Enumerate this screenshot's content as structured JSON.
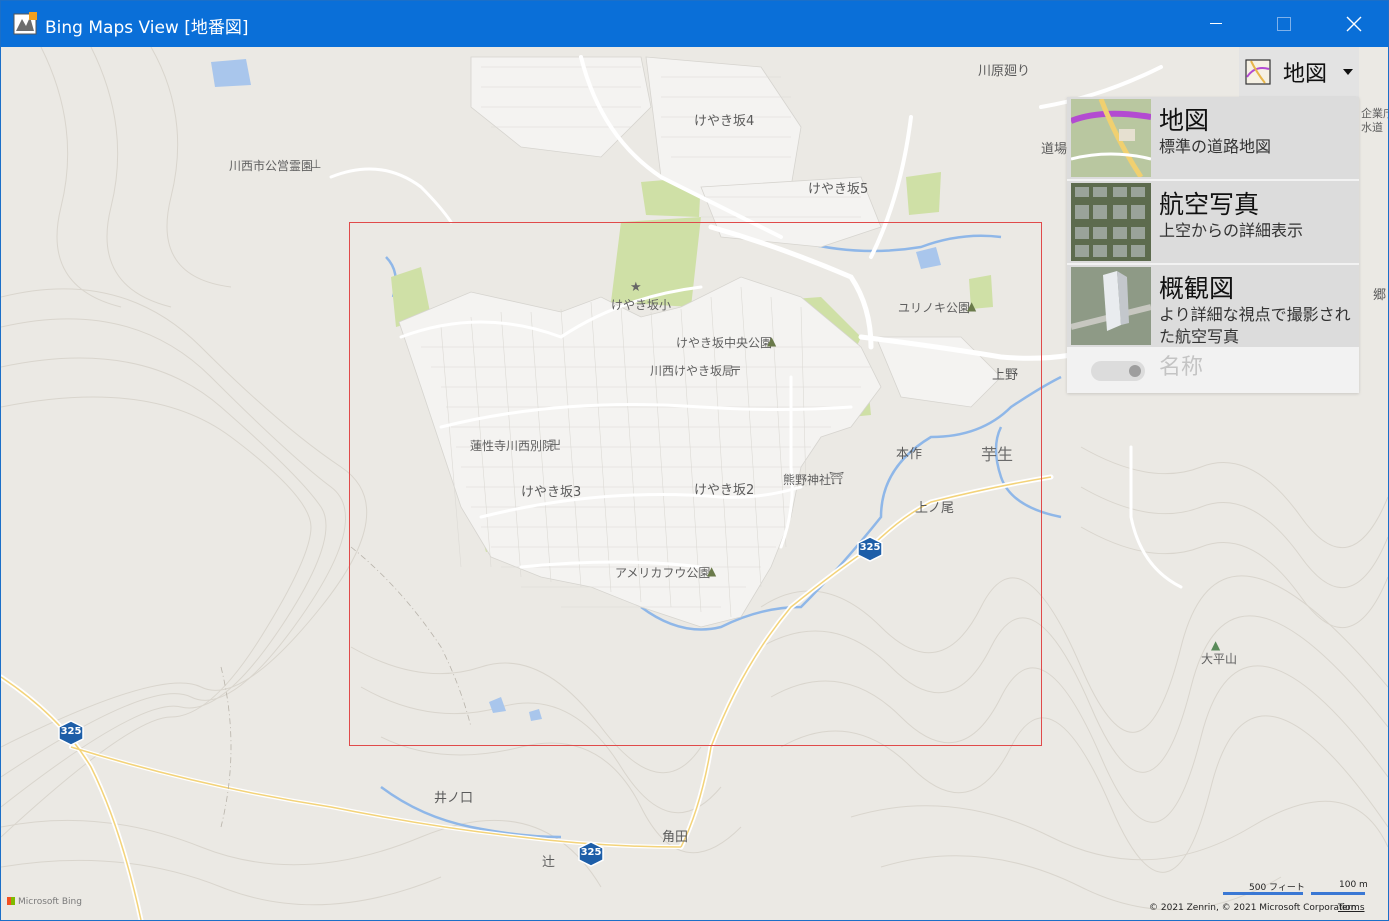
{
  "window": {
    "title": "Bing Maps View [地番図]"
  },
  "map_style": {
    "current": "地図",
    "options": [
      {
        "name": "地図",
        "description": "標準の道路地図",
        "selected": true
      },
      {
        "name": "航空写真",
        "description": "上空からの詳細表示",
        "selected": false
      },
      {
        "name": "概観図",
        "description": "より詳細な視点で撮影された航空写真",
        "selected": false
      }
    ],
    "names_toggle_label": "名称",
    "names_toggle_on": false
  },
  "map_labels": {
    "keyakizaka4": "けやき坂4",
    "keyakizaka5": "けやき坂5",
    "keyakizaka3": "けやき坂3",
    "keyakizaka2": "けやき坂2",
    "keyakizaka_elementary": "けやき坂小",
    "keyakizaka_park": "けやき坂中央公園",
    "post_office": "川西けやき坂局",
    "temple": "蓮性寺川西別院",
    "kumano_shrine": "熊野神社",
    "america_park": "アメリカフウ公園",
    "cemetery": "川西市公営霊園",
    "yurinoki_park": "ユリノキ公園",
    "kawahara": "川原廻り",
    "dojo": "道場",
    "agency": "企業庁",
    "water": "水道",
    "sato": "郷",
    "ueno": "上野",
    "honsaku": "本作",
    "imo": "芋生",
    "uenoo": "上ノ尾",
    "taiheizan": "大平山",
    "inokuchi": "井ノ口",
    "tsunoda": "角田",
    "tsuji": "辻"
  },
  "route_shields": [
    "325",
    "325",
    "325"
  ],
  "scale": {
    "feet": "500 フィート",
    "meters": "100 m"
  },
  "attribution": {
    "logo": "Microsoft Bing",
    "copyright": "© 2021 Zenrin, © 2021 Microsoft Corporation",
    "terms": "Terms"
  },
  "colors": {
    "titlebar": "#0a6fd8",
    "selection_rect": "#e04a4a",
    "map_background": "#ebe9e4",
    "park": "#cfe0a6",
    "water": "#8fb7e8",
    "route_shield": "#1d5ea8"
  }
}
